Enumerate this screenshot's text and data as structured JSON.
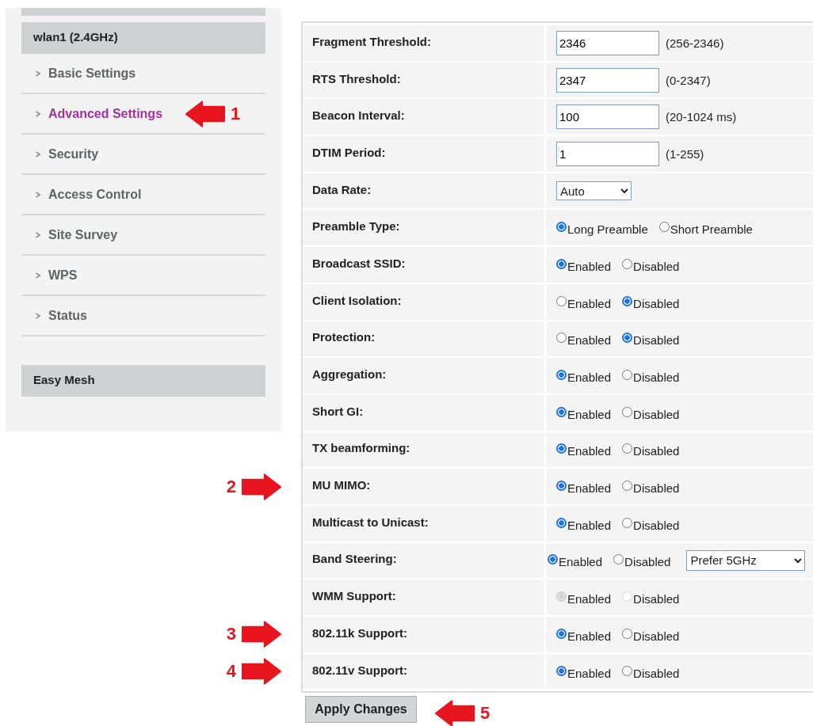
{
  "sidebar": {
    "sections": [
      {
        "title": "wlan1 (2.4GHz)",
        "items": [
          {
            "label": "Basic Settings",
            "selected": false
          },
          {
            "label": "Advanced Settings",
            "selected": true,
            "marker": "1"
          },
          {
            "label": "Security",
            "selected": false
          },
          {
            "label": "Access Control",
            "selected": false
          },
          {
            "label": "Site Survey",
            "selected": false
          },
          {
            "label": "WPS",
            "selected": false
          },
          {
            "label": "Status",
            "selected": false
          }
        ]
      },
      {
        "title": "Easy Mesh"
      }
    ]
  },
  "form": {
    "rows": [
      {
        "label": "Fragment Threshold:",
        "kind": "text",
        "value": "2346",
        "hint": "(256-2346)"
      },
      {
        "label": "RTS Threshold:",
        "kind": "text",
        "value": "2347",
        "hint": "(0-2347)"
      },
      {
        "label": "Beacon Interval:",
        "kind": "text",
        "value": "100",
        "hint": "(20-1024 ms)"
      },
      {
        "label": "DTIM Period:",
        "kind": "text",
        "value": "1",
        "hint": "(1-255)"
      },
      {
        "label": "Data Rate:",
        "kind": "select",
        "value": "Auto"
      },
      {
        "label": "Preamble Type:",
        "kind": "radio",
        "disabled": false,
        "options": [
          {
            "label": "Long Preamble",
            "selected": true
          },
          {
            "label": "Short Preamble",
            "selected": false
          }
        ]
      },
      {
        "label": "Broadcast SSID:",
        "kind": "radio",
        "disabled": false,
        "options": [
          {
            "label": "Enabled",
            "selected": true
          },
          {
            "label": "Disabled",
            "selected": false
          }
        ]
      },
      {
        "label": "Client Isolation:",
        "kind": "radio",
        "disabled": false,
        "options": [
          {
            "label": "Enabled",
            "selected": false
          },
          {
            "label": "Disabled",
            "selected": true
          }
        ]
      },
      {
        "label": "Protection:",
        "kind": "radio",
        "disabled": false,
        "options": [
          {
            "label": "Enabled",
            "selected": false
          },
          {
            "label": "Disabled",
            "selected": true
          }
        ]
      },
      {
        "label": "Aggregation:",
        "kind": "radio",
        "disabled": false,
        "options": [
          {
            "label": "Enabled",
            "selected": true
          },
          {
            "label": "Disabled",
            "selected": false
          }
        ]
      },
      {
        "label": "Short GI:",
        "kind": "radio",
        "disabled": false,
        "options": [
          {
            "label": "Enabled",
            "selected": true
          },
          {
            "label": "Disabled",
            "selected": false
          }
        ]
      },
      {
        "label": "TX beamforming:",
        "kind": "radio",
        "disabled": false,
        "options": [
          {
            "label": "Enabled",
            "selected": true
          },
          {
            "label": "Disabled",
            "selected": false
          }
        ]
      },
      {
        "label": "MU MIMO:",
        "kind": "radio",
        "disabled": false,
        "marker": "2",
        "options": [
          {
            "label": "Enabled",
            "selected": true
          },
          {
            "label": "Disabled",
            "selected": false
          }
        ]
      },
      {
        "label": "Multicast to Unicast:",
        "kind": "radio",
        "disabled": false,
        "options": [
          {
            "label": "Enabled",
            "selected": true
          },
          {
            "label": "Disabled",
            "selected": false
          }
        ]
      },
      {
        "label": "Band Steering:",
        "kind": "radio",
        "disabled": false,
        "select": "Prefer 5GHz",
        "options": [
          {
            "label": "Enabled",
            "selected": true
          },
          {
            "label": "Disabled",
            "selected": false
          }
        ]
      },
      {
        "label": "WMM Support:",
        "kind": "radio",
        "disabled": true,
        "options": [
          {
            "label": "Enabled",
            "selected": true
          },
          {
            "label": "Disabled",
            "selected": false
          }
        ]
      },
      {
        "label": "802.11k Support:",
        "kind": "radio",
        "disabled": false,
        "marker": "3",
        "options": [
          {
            "label": "Enabled",
            "selected": true
          },
          {
            "label": "Disabled",
            "selected": false
          }
        ]
      },
      {
        "label": "802.11v Support:",
        "kind": "radio",
        "disabled": false,
        "marker": "4",
        "options": [
          {
            "label": "Enabled",
            "selected": true
          },
          {
            "label": "Disabled",
            "selected": false
          }
        ]
      }
    ],
    "apply_button": {
      "label": "Apply Changes",
      "marker": "5"
    }
  }
}
